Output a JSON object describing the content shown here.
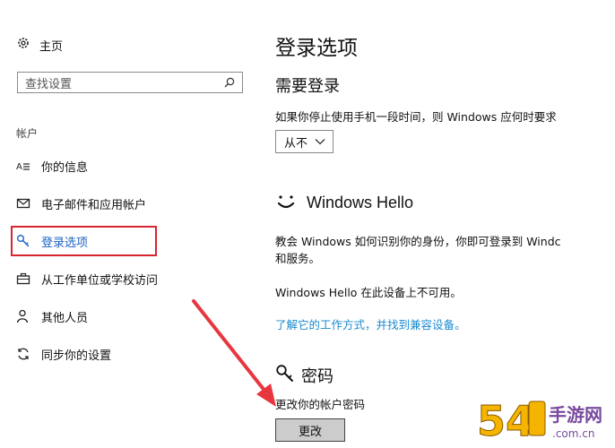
{
  "sidebar": {
    "home_label": "主页",
    "search_placeholder": "查找设置",
    "section_label": "帐户",
    "items": [
      {
        "label": "你的信息",
        "icon": "user-card-icon"
      },
      {
        "label": "电子邮件和应用帐户",
        "icon": "mail-icon"
      },
      {
        "label": "登录选项",
        "icon": "key-icon",
        "active": true
      },
      {
        "label": "从工作单位或学校访问",
        "icon": "briefcase-icon"
      },
      {
        "label": "其他人员",
        "icon": "person-icon"
      },
      {
        "label": "同步你的设置",
        "icon": "sync-icon"
      }
    ]
  },
  "main": {
    "title": "登录选项",
    "require_signin": {
      "heading": "需要登录",
      "description": "如果你停止使用手机一段时间，则 Windows 应何时要求",
      "select_value": "从不"
    },
    "hello": {
      "heading": "Windows Hello",
      "description_line1": "教会 Windows 如何识别你的身份，你即可登录到 Windc",
      "description_line2": "和服务。",
      "unavailable": "Windows Hello 在此设备上不可用。",
      "link": "了解它的工作方式，并找到兼容设备。"
    },
    "password": {
      "heading": "密码",
      "description": "更改你的帐户密码",
      "button": "更改"
    }
  },
  "colors": {
    "accent": "#1b63c6",
    "link": "#1b8ad0",
    "highlight": "#d7262f",
    "arrow": "#e8363f"
  },
  "watermark": {
    "text_digits": "54",
    "text_chars": "手游网",
    "text_domain": ".com.cn"
  }
}
